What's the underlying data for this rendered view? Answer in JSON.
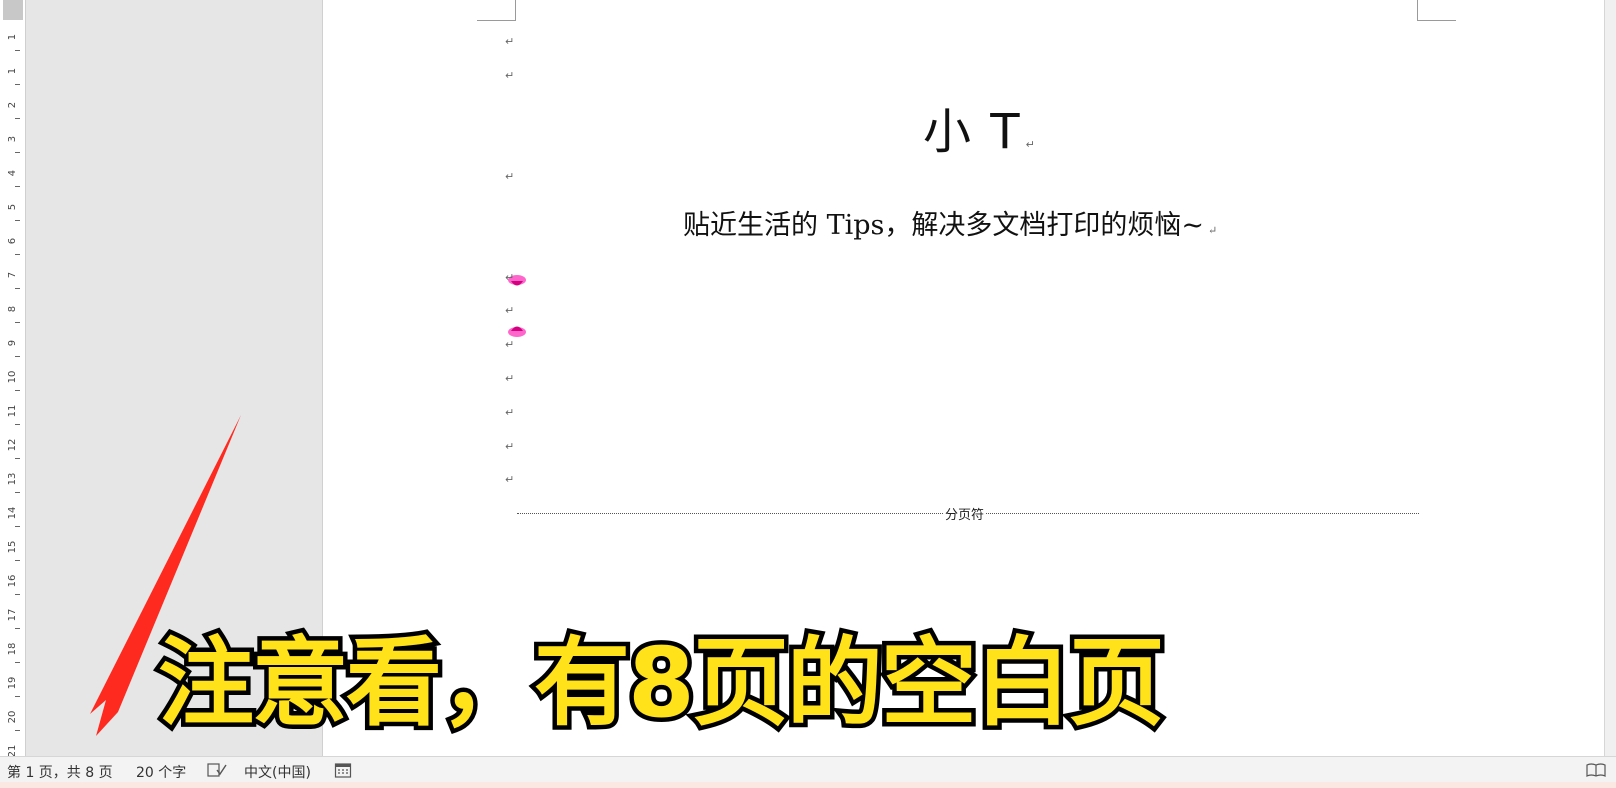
{
  "document": {
    "title": "小 T",
    "subtitle": "贴近生活的 Tips，解决多文档打印的烦恼~",
    "paragraph_mark": "↵",
    "page_break_label": "分页符"
  },
  "ruler": {
    "ticks": [
      "1",
      "1",
      "2",
      "3",
      "4",
      "5",
      "6",
      "7",
      "8",
      "9",
      "10",
      "11",
      "12",
      "13",
      "14",
      "15",
      "16",
      "17",
      "18",
      "19",
      "20",
      "21"
    ]
  },
  "overlay": {
    "caption": "注意看，有8页的空白页",
    "caption_color": "#ffe21a",
    "arrow_color": "#ff2a1f"
  },
  "statusbar": {
    "page_info": "第 1 页，共 8 页",
    "word_count": "20 个字",
    "language": "中文(中国)"
  }
}
